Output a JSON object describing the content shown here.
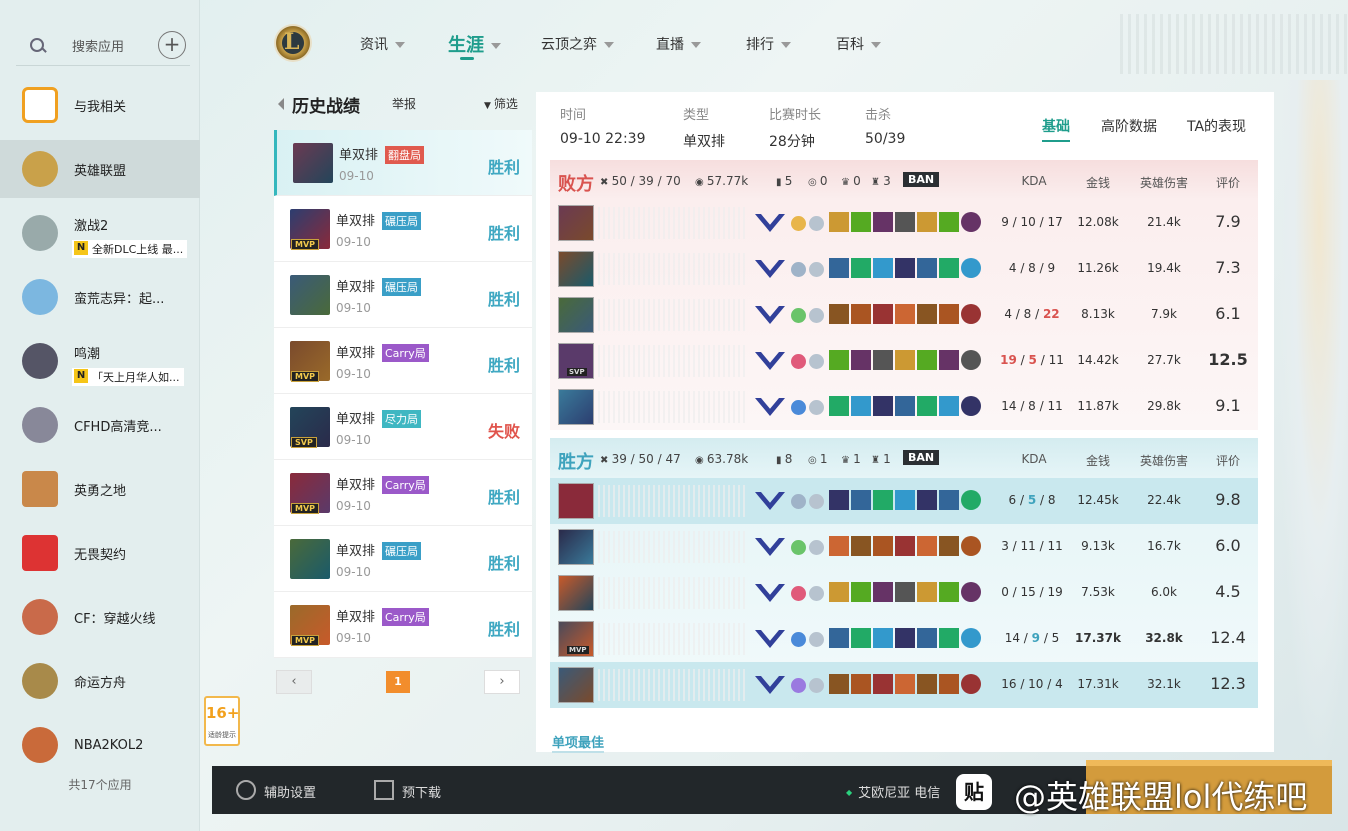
{
  "sidebar": {
    "search_label": "搜索应用",
    "apps": [
      {
        "name": "与我相关",
        "sub": ""
      },
      {
        "name": "英雄联盟",
        "sub": ""
      },
      {
        "name": "激战2",
        "sub": "全新DLC上线 最..."
      },
      {
        "name": "蛮荒志异：起...",
        "sub": ""
      },
      {
        "name": "鸣潮",
        "sub": "「天上月华人如..."
      },
      {
        "name": "CFHD高清竞...",
        "sub": ""
      },
      {
        "name": "英勇之地",
        "sub": ""
      },
      {
        "name": "无畏契约",
        "sub": ""
      },
      {
        "name": "CF：穿越火线",
        "sub": ""
      },
      {
        "name": "命运方舟",
        "sub": ""
      },
      {
        "name": "NBA2KOL2",
        "sub": ""
      }
    ],
    "app_count": "共17个应用",
    "age_badge": {
      "num": "16+",
      "text": "适龄提示"
    }
  },
  "nav": [
    "资讯",
    "生涯",
    "云顶之弈",
    "直播",
    "排行",
    "百科"
  ],
  "history": {
    "title": "历史战绩",
    "report": "举报",
    "filter": "筛选",
    "matches": [
      {
        "mode": "单双排",
        "tag": "翻盘局",
        "tag_color": "#e05a4e",
        "date": "09-10",
        "result": "胜利",
        "win": true,
        "badge": ""
      },
      {
        "mode": "单双排",
        "tag": "碾压局",
        "tag_color": "#3a9fc7",
        "date": "09-10",
        "result": "胜利",
        "win": true,
        "badge": "MVP"
      },
      {
        "mode": "单双排",
        "tag": "碾压局",
        "tag_color": "#3a9fc7",
        "date": "09-10",
        "result": "胜利",
        "win": true,
        "badge": ""
      },
      {
        "mode": "单双排",
        "tag": "Carry局",
        "tag_color": "#9b59c9",
        "date": "09-10",
        "result": "胜利",
        "win": true,
        "badge": "MVP"
      },
      {
        "mode": "单双排",
        "tag": "尽力局",
        "tag_color": "#3fb7c2",
        "date": "09-10",
        "result": "失败",
        "win": false,
        "badge": "SVP"
      },
      {
        "mode": "单双排",
        "tag": "Carry局",
        "tag_color": "#9b59c9",
        "date": "09-10",
        "result": "胜利",
        "win": true,
        "badge": "MVP"
      },
      {
        "mode": "单双排",
        "tag": "碾压局",
        "tag_color": "#3a9fc7",
        "date": "09-10",
        "result": "胜利",
        "win": true,
        "badge": ""
      },
      {
        "mode": "单双排",
        "tag": "Carry局",
        "tag_color": "#9b59c9",
        "date": "09-10",
        "result": "胜利",
        "win": true,
        "badge": "MVP"
      }
    ],
    "page": "1"
  },
  "detail": {
    "meta": [
      {
        "k": "时间",
        "v": "09-10 22:39"
      },
      {
        "k": "类型",
        "v": "单双排"
      },
      {
        "k": "比赛时长",
        "v": "28分钟"
      },
      {
        "k": "击杀",
        "v": "50/39"
      }
    ],
    "tabs": [
      "基础",
      "高阶数据",
      "TA的表现"
    ],
    "headers": {
      "kda": "KDA",
      "gold": "金钱",
      "dmg": "英雄伤害",
      "score": "评价",
      "ban": "BAN"
    },
    "teams": [
      {
        "name": "败方",
        "kda": "50 / 39 / 70",
        "gold": "57.77k",
        "towers": "5",
        "dragons": "0",
        "barons": "0",
        "heralds": "3",
        "players": [
          {
            "k": "9",
            "d": "10",
            "a": "17",
            "gold": "12.08k",
            "dmg": "21.4k",
            "score": "7.9",
            "hl": ""
          },
          {
            "k": "4",
            "d": "8",
            "a": "9",
            "gold": "11.26k",
            "dmg": "19.4k",
            "score": "7.3",
            "hl": ""
          },
          {
            "k": "4",
            "d": "8",
            "a": "22",
            "gold": "8.13k",
            "dmg": "7.9k",
            "score": "6.1",
            "hl": "a"
          },
          {
            "k": "19",
            "d": "5",
            "a": "11",
            "gold": "14.42k",
            "dmg": "27.7k",
            "score": "12.5",
            "hl": "kd",
            "svp": "SVP"
          },
          {
            "k": "14",
            "d": "8",
            "a": "11",
            "gold": "11.87k",
            "dmg": "29.8k",
            "score": "9.1",
            "hl": ""
          }
        ]
      },
      {
        "name": "胜方",
        "kda": "39 / 50 / 47",
        "gold": "63.78k",
        "towers": "8",
        "dragons": "1",
        "barons": "1",
        "heralds": "1",
        "players": [
          {
            "k": "6",
            "d": "5",
            "a": "8",
            "gold": "12.45k",
            "dmg": "22.4k",
            "score": "9.8",
            "hl": "d",
            "row": true
          },
          {
            "k": "3",
            "d": "11",
            "a": "11",
            "gold": "9.13k",
            "dmg": "16.7k",
            "score": "6.0",
            "hl": ""
          },
          {
            "k": "0",
            "d": "15",
            "a": "19",
            "gold": "7.53k",
            "dmg": "6.0k",
            "score": "4.5",
            "hl": ""
          },
          {
            "k": "14",
            "d": "9",
            "a": "5",
            "gold": "17.37k",
            "dmg": "32.8k",
            "score": "12.4",
            "hl": "gd",
            "svp": "MVP"
          },
          {
            "k": "16",
            "d": "10",
            "a": "4",
            "gold": "17.31k",
            "dmg": "32.1k",
            "score": "12.3",
            "hl": "",
            "row": true
          }
        ]
      }
    ],
    "best": "单项最佳"
  },
  "bottom": {
    "settings": "辅助设置",
    "download": "预下载",
    "server": "艾欧尼亚 电信",
    "watermark": "@英雄联盟lol代练吧",
    "tieba": "贴"
  }
}
